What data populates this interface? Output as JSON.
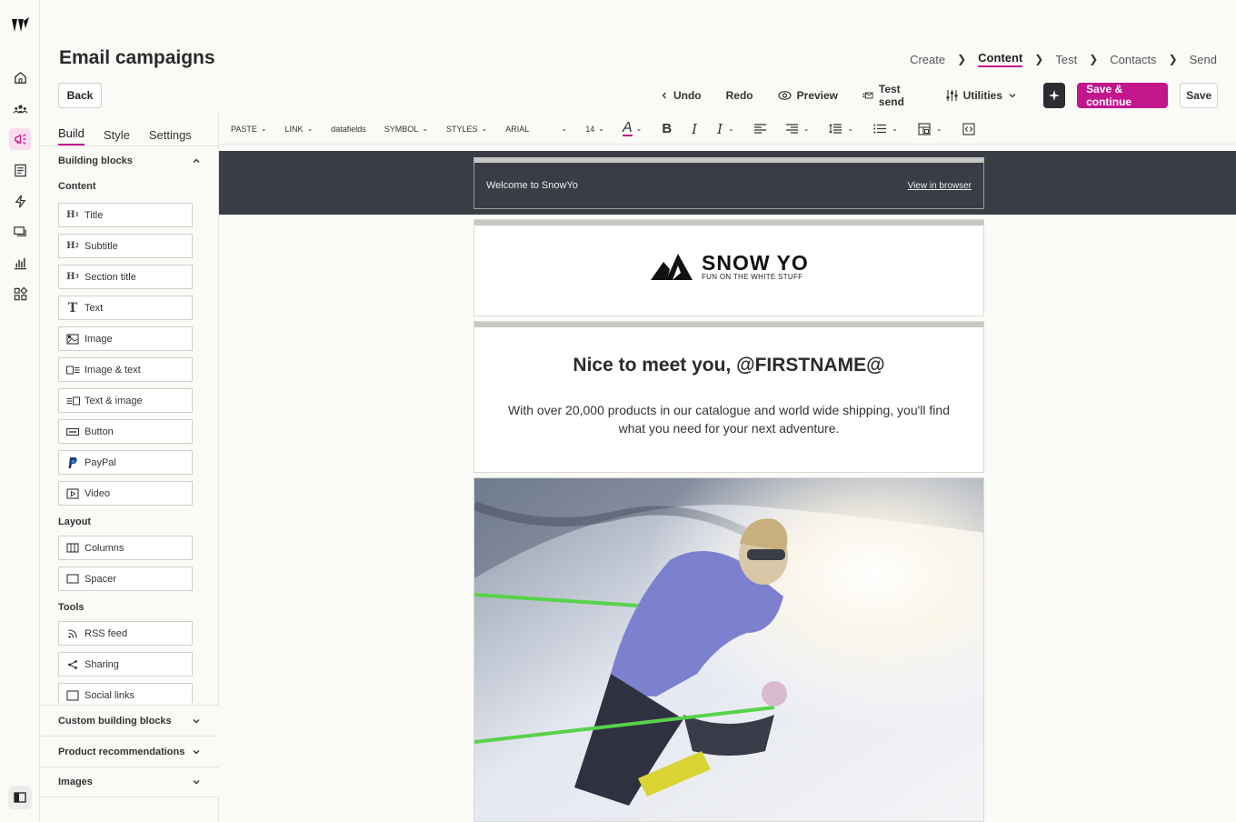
{
  "header": {
    "title": "Email campaigns",
    "back": "Back",
    "breadcrumbs": [
      "Create",
      "Content",
      "Test",
      "Contacts",
      "Send"
    ],
    "active_step": "Content"
  },
  "actions": {
    "undo": "Undo",
    "redo": "Redo",
    "preview": "Preview",
    "test_send": "Test send",
    "utilities": "Utilities",
    "save_continue": "Save & continue",
    "save": "Save"
  },
  "sidebar": {
    "tabs": [
      "Build",
      "Style",
      "Settings"
    ],
    "building_blocks": "Building blocks",
    "content_label": "Content",
    "content_blocks": [
      {
        "label": "Title",
        "icon": "H1"
      },
      {
        "label": "Subtitle",
        "icon": "H2"
      },
      {
        "label": "Section title",
        "icon": "H3"
      },
      {
        "label": "Text",
        "icon": "T"
      },
      {
        "label": "Image",
        "icon": "image-icon"
      },
      {
        "label": "Image & text",
        "icon": "image-text-icon"
      },
      {
        "label": "Text & image",
        "icon": "text-image-icon"
      },
      {
        "label": "Button",
        "icon": "button-icon"
      },
      {
        "label": "PayPal",
        "icon": "paypal-icon"
      },
      {
        "label": "Video",
        "icon": "video-icon"
      }
    ],
    "layout_label": "Layout",
    "layout_blocks": [
      {
        "label": "Columns",
        "icon": "columns-icon"
      },
      {
        "label": "Spacer",
        "icon": "spacer-icon"
      }
    ],
    "tools_label": "Tools",
    "tools_blocks": [
      {
        "label": "RSS feed",
        "icon": "rss-icon"
      },
      {
        "label": "Sharing",
        "icon": "share-icon"
      },
      {
        "label": "Social links",
        "icon": "social-icon"
      }
    ],
    "custom_blocks": "Custom building blocks",
    "product_recs": "Product recommendations",
    "images": "Images"
  },
  "toolbar": {
    "paste": "PASTE",
    "link": "LINK",
    "datafields": "datafields",
    "symbol": "SYMBOL",
    "styles": "STYLES",
    "font": "ARIAL",
    "size": "14",
    "font_color_accent": "#c4168c"
  },
  "email": {
    "preheader": "Welcome to SnowYo",
    "view_in_browser": "View in browser",
    "logo_name": "SNOW YO",
    "logo_tagline": "FUN ON THE WHITE STUFF",
    "heading": "Nice to meet you, @FIRSTNAME@",
    "body": "With over 20,000 products in our catalogue and world wide shipping, you'll find what you need for your next adventure."
  },
  "colors": {
    "accent": "#c4168c",
    "dark_band": "#3a3d45",
    "ai_button": "#2c2d33"
  }
}
